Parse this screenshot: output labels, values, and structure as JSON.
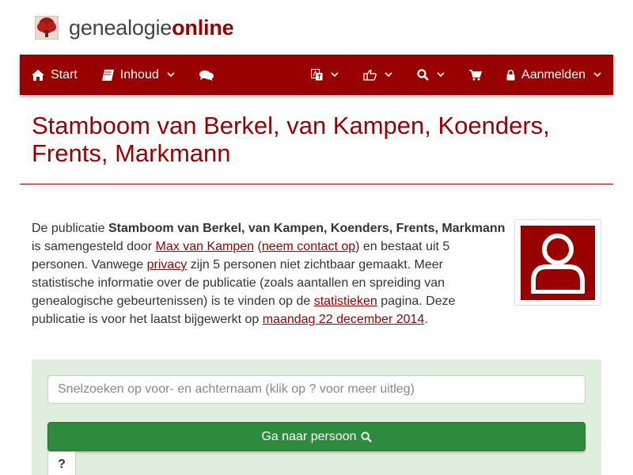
{
  "site": {
    "logo_part1": "genealogie",
    "logo_part2": "online"
  },
  "colors": {
    "brand": "#990000",
    "panel": "#dfeedd",
    "go_button": "#2e8b3e"
  },
  "nav": {
    "start_label": "Start",
    "inhoud_label": "Inhoud",
    "aanmelden_label": "Aanmelden",
    "icons": [
      "home-icon",
      "book-icon",
      "comments-icon",
      "language-icon",
      "share-icon",
      "search-icon",
      "cart-icon",
      "lock-icon"
    ]
  },
  "page": {
    "title": "Stamboom van Berkel, van Kampen, Koenders, Frents, Markmann"
  },
  "intro": {
    "t1": "De publicatie ",
    "pub_name": "Stamboom van Berkel, van Kampen, Koenders, Frents, Markmann",
    "t2": " is samengesteld door ",
    "author": "Max van Kampen",
    "t3": " (",
    "contact": "neem contact op",
    "t4": ") en bestaat uit 5 personen. Vanwege ",
    "privacy": "privacy",
    "t5": " zijn 5 personen niet zichtbaar gemaakt. Meer statistische informatie over de publicatie (zoals aantallen en spreiding van genealogische gebeurtenissen) is te vinden op de ",
    "stats": "statistieken",
    "t6": " pagina. Deze publicatie is voor het laatst bijgewerkt op ",
    "updated": "maandag 22 december 2014",
    "t7": "."
  },
  "search": {
    "placeholder": "Snelzoeken op voor- en achternaam (klik op ? voor meer uitleg)",
    "go_label": "Ga naar persoon",
    "help_label": "?"
  }
}
